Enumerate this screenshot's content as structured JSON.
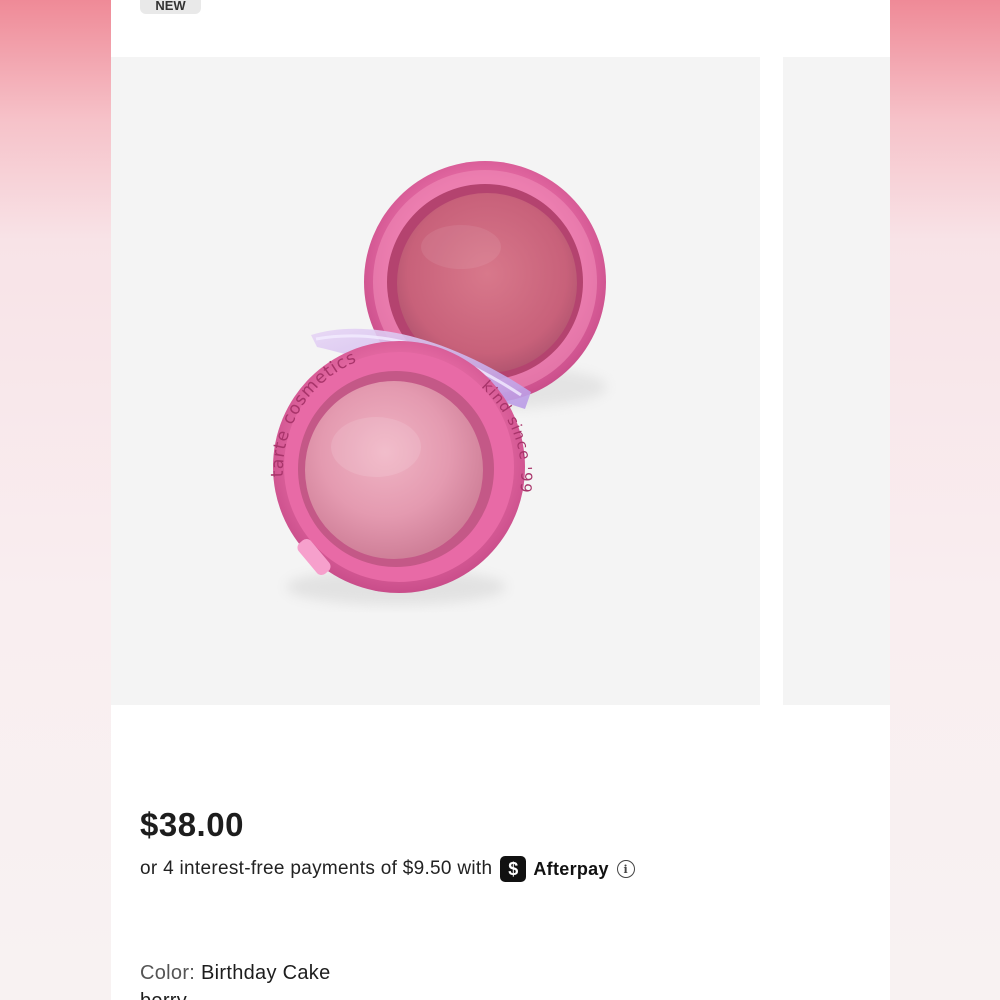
{
  "badge": {
    "label": "NEW"
  },
  "product": {
    "image_alt": "tarte cosmetics blush compact",
    "compact_text_top": "tarte cosmetics",
    "compact_text_side": "kind since '99",
    "price": "$38.00",
    "installments": {
      "text": "or 4 interest-free payments of $9.50 with",
      "provider_icon": "$",
      "provider_name": "Afterpay",
      "info_icon": "i"
    },
    "color": {
      "label": "Color:",
      "value": "Birthday Cake",
      "value_continued": "berry"
    }
  },
  "colors": {
    "page_gradient_top": "#ef8a97",
    "compact_pink": "#e0609a",
    "blush_rose": "#cf6a80"
  }
}
